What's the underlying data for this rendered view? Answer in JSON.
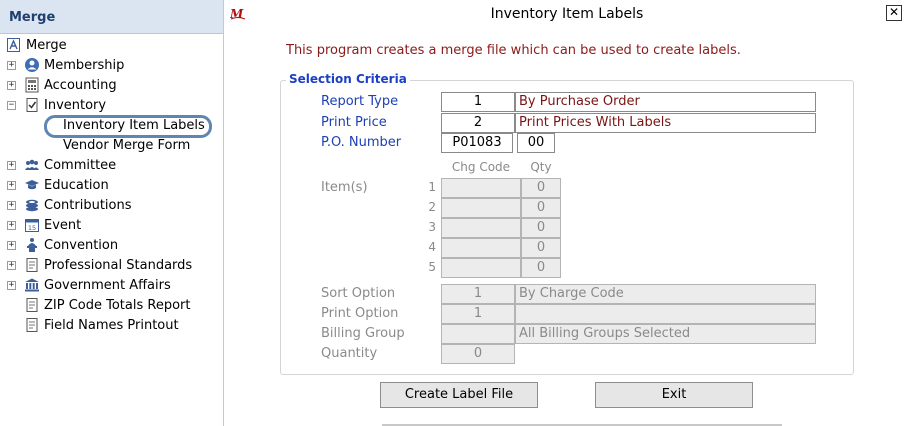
{
  "nav": {
    "header": "Merge",
    "items": [
      {
        "label": "Merge"
      },
      {
        "label": "Membership"
      },
      {
        "label": "Accounting"
      },
      {
        "label": "Inventory"
      },
      {
        "label": "Inventory Item Labels"
      },
      {
        "label": "Vendor Merge Form"
      },
      {
        "label": "Committee"
      },
      {
        "label": "Education"
      },
      {
        "label": "Contributions"
      },
      {
        "label": "Event"
      },
      {
        "label": "Convention"
      },
      {
        "label": "Professional Standards"
      },
      {
        "label": "Government Affairs"
      },
      {
        "label": "ZIP Code Totals Report"
      },
      {
        "label": "Field Names Printout"
      }
    ],
    "selected": "Inventory Item Labels"
  },
  "dialog": {
    "title": "Inventory Item Labels",
    "close_glyph": "✕",
    "intro": "This program creates a merge file which can be used to create labels.",
    "group_title": "Selection Criteria",
    "report_type": {
      "label": "Report Type",
      "code": "1",
      "desc": "By Purchase Order"
    },
    "print_price": {
      "label": "Print Price",
      "code": "2",
      "desc": "Print Prices With Labels"
    },
    "po_number": {
      "label": "P.O. Number",
      "value": "P01083",
      "suffix": "00"
    },
    "items": {
      "label": "Item(s)",
      "col_code": "Chg Code",
      "col_qty": "Qty",
      "rows": [
        {
          "num": "1",
          "code": "",
          "qty": "0"
        },
        {
          "num": "2",
          "code": "",
          "qty": "0"
        },
        {
          "num": "3",
          "code": "",
          "qty": "0"
        },
        {
          "num": "4",
          "code": "",
          "qty": "0"
        },
        {
          "num": "5",
          "code": "",
          "qty": "0"
        }
      ]
    },
    "sort_option": {
      "label": "Sort Option",
      "code": "1",
      "desc": "By Charge Code"
    },
    "print_option": {
      "label": "Print Option",
      "code": "1",
      "desc": ""
    },
    "billing_group": {
      "label": "Billing Group",
      "code": "",
      "desc": "All Billing Groups Selected"
    },
    "quantity": {
      "label": "Quantity",
      "value": "0"
    },
    "buttons": {
      "create": "Create Label File",
      "exit": "Exit"
    }
  },
  "colors": {
    "accent_blue": "#1c3fb4",
    "intro_red": "#8b1a1a",
    "nav_header_bg": "#dbe5f1",
    "selection_ring": "#5f86b3"
  }
}
